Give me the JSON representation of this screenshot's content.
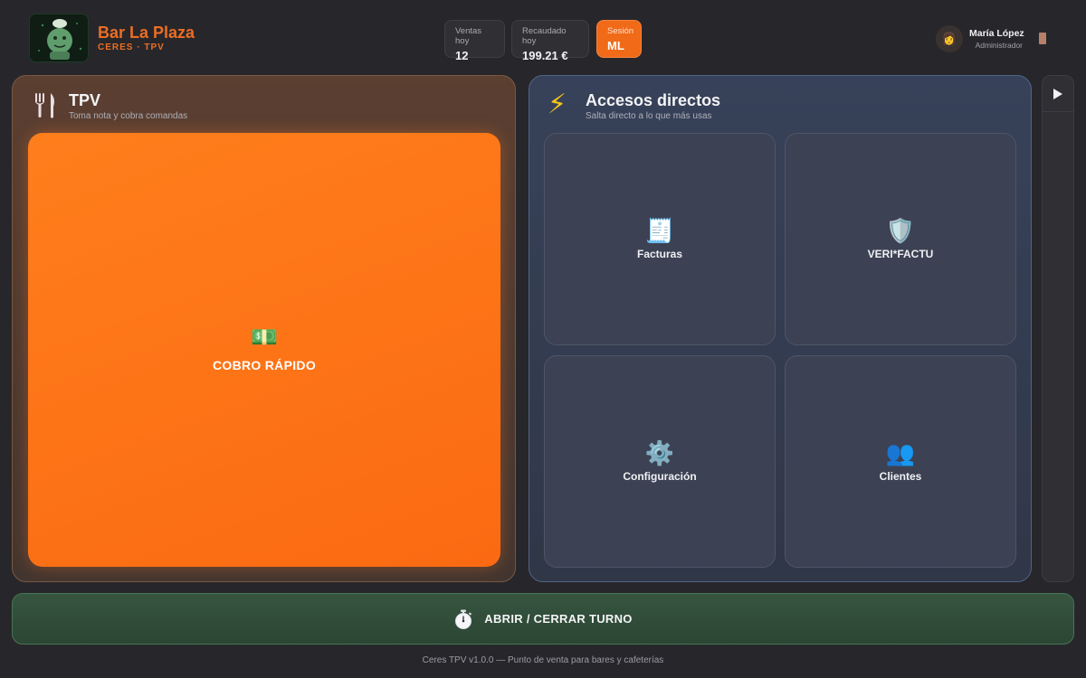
{
  "header": {
    "brand_name": "Bar La Plaza",
    "brand_sub": "CERES · TPV",
    "stats": [
      {
        "label": "Ventas hoy",
        "value": "12"
      },
      {
        "label": "Recaudado hoy",
        "value": "199.21 €"
      },
      {
        "label": "Sesión",
        "value": "ML"
      }
    ],
    "user": {
      "name": "María López",
      "role": "Administrador",
      "avatar_glyph": "👩"
    }
  },
  "tpv": {
    "title": "TPV",
    "subtitle": "Toma nota y cobra comandas",
    "quick_pay": {
      "emoji": "💵",
      "label": "COBRO RÁPIDO"
    }
  },
  "shortcuts": {
    "icon": "⚡",
    "title": "Accesos directos",
    "subtitle": "Salta directo a lo que más usas",
    "tiles": [
      {
        "emoji": "🧾",
        "label": "Facturas"
      },
      {
        "emoji": "🛡️",
        "label": "VERI*FACTU"
      },
      {
        "emoji": "⚙️",
        "label": "Configuración"
      },
      {
        "emoji": "👥",
        "label": "Clientes"
      }
    ]
  },
  "shift": {
    "label": "ABRIR / CERRAR TURNO"
  },
  "footer": {
    "text": "Ceres TPV v1.0.0 — Punto de venta para bares y cafeterías"
  },
  "colors": {
    "accent": "#ec6d24",
    "quick_pay": "#fb6a12",
    "shift": "#2c4634",
    "background": "#27272b"
  }
}
